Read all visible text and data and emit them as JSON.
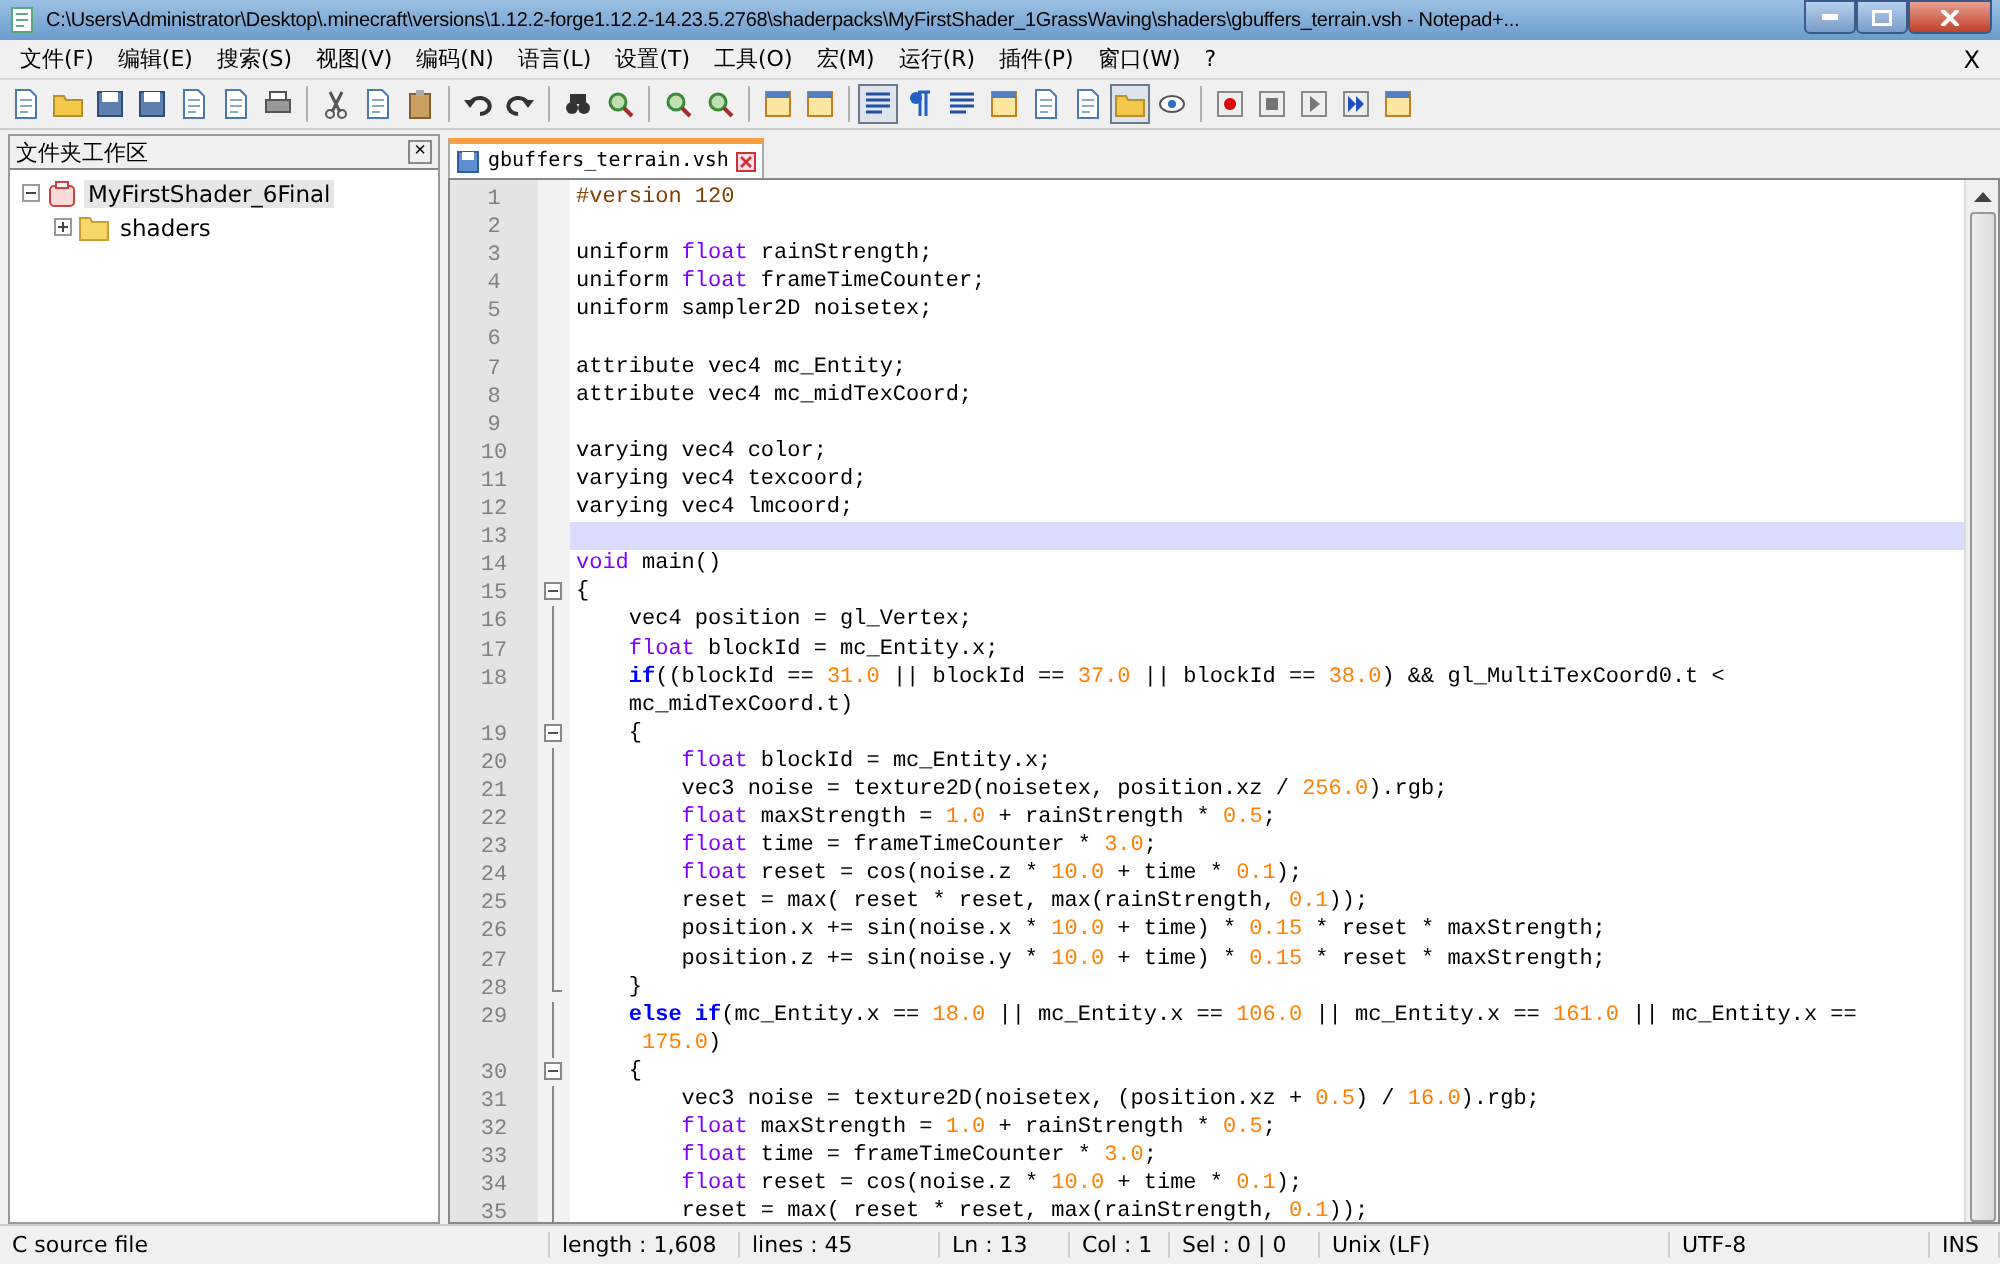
{
  "window": {
    "title": "C:\\Users\\Administrator\\Desktop\\.minecraft\\versions\\1.12.2-forge1.12.2-14.23.5.2768\\shaderpacks\\MyFirstShader_1GrassWaving\\shaders\\gbuffers_terrain.vsh - Notepad+..."
  },
  "menu": [
    "文件(F)",
    "编辑(E)",
    "搜索(S)",
    "视图(V)",
    "编码(N)",
    "语言(L)",
    "设置(T)",
    "工具(O)",
    "宏(M)",
    "运行(R)",
    "插件(P)",
    "窗口(W)",
    "?"
  ],
  "menu_close": "X",
  "toolbar": [
    [
      {
        "pressed": false
      },
      {
        "pressed": false
      },
      {
        "pressed": false
      },
      {
        "pressed": false
      },
      {
        "pressed": false
      },
      {
        "pressed": false
      },
      {
        "pressed": false
      }
    ],
    [
      {
        "pressed": false
      },
      {
        "pressed": false
      },
      {
        "pressed": false
      }
    ],
    [
      {
        "pressed": false
      },
      {
        "pressed": false
      }
    ],
    [
      {
        "pressed": false
      },
      {
        "pressed": false
      }
    ],
    [
      {
        "pressed": false
      },
      {
        "pressed": false
      }
    ],
    [
      {
        "pressed": false
      },
      {
        "pressed": false
      }
    ],
    [
      {
        "pressed": true
      },
      {
        "pressed": false
      },
      {
        "pressed": false
      },
      {
        "pressed": false
      },
      {
        "pressed": false
      },
      {
        "pressed": false
      },
      {
        "pressed": true
      },
      {
        "pressed": false
      }
    ],
    [
      {
        "pressed": false
      },
      {
        "pressed": false
      },
      {
        "pressed": false
      },
      {
        "pressed": false
      },
      {
        "pressed": false
      }
    ]
  ],
  "sidebar": {
    "title": "文件夹工作区",
    "close": "×",
    "tree": [
      {
        "label": "MyFirstShader_6Final",
        "expanded": true,
        "selected": true,
        "kind": "project",
        "children": [
          {
            "label": "shaders",
            "expanded": false,
            "selected": false,
            "kind": "folder"
          }
        ]
      }
    ]
  },
  "tabs": [
    {
      "label": "gbuffers_terrain.vsh",
      "selected": true
    }
  ],
  "editor": {
    "lines": [
      {
        "number": "1",
        "current": false,
        "tokens": [
          {
            "kind": "pp",
            "text": "#version 120"
          }
        ]
      },
      {
        "number": "2",
        "current": false
      },
      {
        "number": "3",
        "current": false,
        "tokens": [
          {
            "kind": "plain",
            "text": "uniform "
          },
          {
            "kind": "kw",
            "text": "float"
          },
          {
            "kind": "plain",
            "text": " rainStrength;"
          }
        ]
      },
      {
        "number": "4",
        "current": false,
        "tokens": [
          {
            "kind": "plain",
            "text": "uniform "
          },
          {
            "kind": "kw",
            "text": "float"
          },
          {
            "kind": "plain",
            "text": " frameTimeCounter;"
          }
        ]
      },
      {
        "number": "5",
        "current": false,
        "tokens": [
          {
            "kind": "plain",
            "text": "uniform sampler2D noisetex;"
          }
        ]
      },
      {
        "number": "6",
        "current": false
      },
      {
        "number": "7",
        "current": false,
        "tokens": [
          {
            "kind": "plain",
            "text": "attribute vec4 mc_Entity;"
          }
        ]
      },
      {
        "number": "8",
        "current": false,
        "tokens": [
          {
            "kind": "plain",
            "text": "attribute vec4 mc_midTexCoord;"
          }
        ]
      },
      {
        "number": "9",
        "current": false
      },
      {
        "number": "10",
        "current": false,
        "tokens": [
          {
            "kind": "plain",
            "text": "varying vec4 color;"
          }
        ]
      },
      {
        "number": "11",
        "current": false,
        "tokens": [
          {
            "kind": "plain",
            "text": "varying vec4 texcoord;"
          }
        ]
      },
      {
        "number": "12",
        "current": false,
        "tokens": [
          {
            "kind": "plain",
            "text": "varying vec4 lmcoord;"
          }
        ]
      },
      {
        "number": "13",
        "current": true
      },
      {
        "number": "14",
        "current": false,
        "tokens": [
          {
            "kind": "kw",
            "text": "void"
          },
          {
            "kind": "plain",
            "text": " main()"
          }
        ]
      },
      {
        "number": "15",
        "current": false,
        "kind": "fold",
        "tokens": [
          {
            "kind": "plain",
            "text": "{"
          }
        ]
      },
      {
        "number": "16",
        "current": false,
        "tokens": [
          {
            "kind": "plain",
            "text": "    vec4 position = gl_Vertex;"
          }
        ]
      },
      {
        "number": "17",
        "current": false,
        "tokens": [
          {
            "kind": "kw",
            "text": "    float"
          },
          {
            "kind": "plain",
            "text": " blockId = mc_Entity.x;"
          }
        ]
      },
      {
        "number": "18",
        "current": false,
        "tokens": [
          {
            "kind": "ctl",
            "text": "    if"
          },
          {
            "kind": "plain",
            "text": "((blockId == "
          },
          {
            "kind": "num",
            "text": "31.0"
          },
          {
            "kind": "plain",
            "text": " || blockId == "
          },
          {
            "kind": "num",
            "text": "37.0"
          },
          {
            "kind": "plain",
            "text": " || blockId == "
          },
          {
            "kind": "num",
            "text": "38.0"
          },
          {
            "kind": "plain",
            "text": ") && gl_MultiTexCoord0.t <"
          }
        ],
        "continuation": [
          {
            "kind": "plain",
            "text": "    mc_midTexCoord.t)"
          }
        ]
      },
      {
        "number": "19",
        "current": false,
        "kind": "fold",
        "tokens": [
          {
            "kind": "plain",
            "text": "    {"
          }
        ]
      },
      {
        "number": "20",
        "current": false,
        "tokens": [
          {
            "kind": "kw",
            "text": "        float"
          },
          {
            "kind": "plain",
            "text": " blockId = mc_Entity.x;"
          }
        ]
      },
      {
        "number": "21",
        "current": false,
        "tokens": [
          {
            "kind": "plain",
            "text": "        vec3 noise = texture2D(noisetex, position.xz / "
          },
          {
            "kind": "num",
            "text": "256.0"
          },
          {
            "kind": "plain",
            "text": ").rgb;"
          }
        ]
      },
      {
        "number": "22",
        "current": false,
        "tokens": [
          {
            "kind": "kw",
            "text": "        float"
          },
          {
            "kind": "plain",
            "text": " maxStrength = "
          },
          {
            "kind": "num",
            "text": "1.0"
          },
          {
            "kind": "plain",
            "text": " + rainStrength * "
          },
          {
            "kind": "num",
            "text": "0.5"
          },
          {
            "kind": "plain",
            "text": ";"
          }
        ]
      },
      {
        "number": "23",
        "current": false,
        "tokens": [
          {
            "kind": "kw",
            "text": "        float"
          },
          {
            "kind": "plain",
            "text": " time = frameTimeCounter * "
          },
          {
            "kind": "num",
            "text": "3.0"
          },
          {
            "kind": "plain",
            "text": ";"
          }
        ]
      },
      {
        "number": "24",
        "current": false,
        "tokens": [
          {
            "kind": "kw",
            "text": "        float"
          },
          {
            "kind": "plain",
            "text": " reset = cos(noise.z * "
          },
          {
            "kind": "num",
            "text": "10.0"
          },
          {
            "kind": "plain",
            "text": " + time * "
          },
          {
            "kind": "num",
            "text": "0.1"
          },
          {
            "kind": "plain",
            "text": ");"
          }
        ]
      },
      {
        "number": "25",
        "current": false,
        "tokens": [
          {
            "kind": "plain",
            "text": "        reset = max( reset * reset, max(rainStrength, "
          },
          {
            "kind": "num",
            "text": "0.1"
          },
          {
            "kind": "plain",
            "text": "));"
          }
        ]
      },
      {
        "number": "26",
        "current": false,
        "tokens": [
          {
            "kind": "plain",
            "text": "        position.x += sin(noise.x * "
          },
          {
            "kind": "num",
            "text": "10.0"
          },
          {
            "kind": "plain",
            "text": " + time) * "
          },
          {
            "kind": "num",
            "text": "0.15"
          },
          {
            "kind": "plain",
            "text": " * reset * maxStrength;"
          }
        ]
      },
      {
        "number": "27",
        "current": false,
        "tokens": [
          {
            "kind": "plain",
            "text": "        position.z += sin(noise.y * "
          },
          {
            "kind": "num",
            "text": "10.0"
          },
          {
            "kind": "plain",
            "text": " + time) * "
          },
          {
            "kind": "num",
            "text": "0.15"
          },
          {
            "kind": "plain",
            "text": " * reset * maxStrength;"
          }
        ]
      },
      {
        "number": "28",
        "current": false,
        "kind": "foldend",
        "tokens": [
          {
            "kind": "plain",
            "text": "    }"
          }
        ]
      },
      {
        "number": "29",
        "current": false,
        "tokens": [
          {
            "kind": "ctl",
            "text": "    else if"
          },
          {
            "kind": "plain",
            "text": "(mc_Entity.x == "
          },
          {
            "kind": "num",
            "text": "18.0"
          },
          {
            "kind": "plain",
            "text": " || mc_Entity.x == "
          },
          {
            "kind": "num",
            "text": "106.0"
          },
          {
            "kind": "plain",
            "text": " || mc_Entity.x == "
          },
          {
            "kind": "num",
            "text": "161.0"
          },
          {
            "kind": "plain",
            "text": " || mc_Entity.x =="
          }
        ],
        "continuation": [
          {
            "kind": "num",
            "text": "     175.0"
          },
          {
            "kind": "plain",
            "text": ")"
          }
        ]
      },
      {
        "number": "30",
        "current": false,
        "kind": "fold",
        "tokens": [
          {
            "kind": "plain",
            "text": "    {"
          }
        ]
      },
      {
        "number": "31",
        "current": false,
        "tokens": [
          {
            "kind": "plain",
            "text": "        vec3 noise = texture2D(noisetex, (position.xz + "
          },
          {
            "kind": "num",
            "text": "0.5"
          },
          {
            "kind": "plain",
            "text": ") / "
          },
          {
            "kind": "num",
            "text": "16.0"
          },
          {
            "kind": "plain",
            "text": ").rgb;"
          }
        ]
      },
      {
        "number": "32",
        "current": false,
        "tokens": [
          {
            "kind": "kw",
            "text": "        float"
          },
          {
            "kind": "plain",
            "text": " maxStrength = "
          },
          {
            "kind": "num",
            "text": "1.0"
          },
          {
            "kind": "plain",
            "text": " + rainStrength * "
          },
          {
            "kind": "num",
            "text": "0.5"
          },
          {
            "kind": "plain",
            "text": ";"
          }
        ]
      },
      {
        "number": "33",
        "current": false,
        "tokens": [
          {
            "kind": "kw",
            "text": "        float"
          },
          {
            "kind": "plain",
            "text": " time = frameTimeCounter * "
          },
          {
            "kind": "num",
            "text": "3.0"
          },
          {
            "kind": "plain",
            "text": ";"
          }
        ]
      },
      {
        "number": "34",
        "current": false,
        "tokens": [
          {
            "kind": "kw",
            "text": "        float"
          },
          {
            "kind": "plain",
            "text": " reset = cos(noise.z * "
          },
          {
            "kind": "num",
            "text": "10.0"
          },
          {
            "kind": "plain",
            "text": " + time * "
          },
          {
            "kind": "num",
            "text": "0.1"
          },
          {
            "kind": "plain",
            "text": ");"
          }
        ]
      },
      {
        "number": "35",
        "current": false,
        "tokens": [
          {
            "kind": "plain",
            "text": "        reset = max( reset * reset, max(rainStrength, "
          },
          {
            "kind": "num",
            "text": "0.1"
          },
          {
            "kind": "plain",
            "text": "));"
          }
        ]
      }
    ]
  },
  "status_bar": [
    "C source file",
    "length : 1,608",
    "lines : 45",
    "Ln : 13",
    "Col : 1",
    "Sel : 0 | 0",
    "Unix (LF)",
    "UTF-8",
    "INS"
  ]
}
